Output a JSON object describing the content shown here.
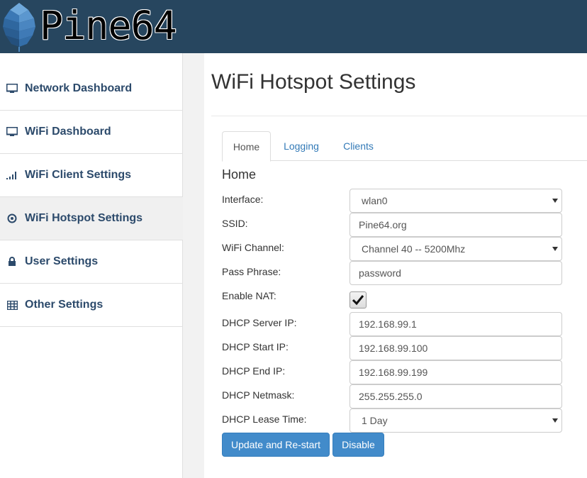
{
  "header": {
    "brand": "Pine64",
    "logo_icon": "pine-cone-logo-icon"
  },
  "colors": {
    "topbar": "#27465f",
    "nav_text": "#2c4a6b",
    "link": "#337ab7",
    "button": "#428bca"
  },
  "sidebar": {
    "items": [
      {
        "label": "Network Dashboard",
        "icon": "monitor-icon",
        "active": false
      },
      {
        "label": "WiFi Dashboard",
        "icon": "monitor-icon",
        "active": false
      },
      {
        "label": "WiFi Client Settings",
        "icon": "signal-bars-icon",
        "active": false
      },
      {
        "label": "WiFi Hotspot Settings",
        "icon": "radio-dot-icon",
        "active": true
      },
      {
        "label": "User Settings",
        "icon": "lock-icon",
        "active": false
      },
      {
        "label": "Other Settings",
        "icon": "table-icon",
        "active": false
      }
    ]
  },
  "main": {
    "title": "WiFi Hotspot Settings",
    "tabs": [
      {
        "label": "Home",
        "active": true
      },
      {
        "label": "Logging",
        "active": false
      },
      {
        "label": "Clients",
        "active": false
      }
    ],
    "section_title": "Home",
    "form": {
      "interface": {
        "label": "Interface:",
        "value": "wlan0"
      },
      "ssid": {
        "label": "SSID:",
        "value": "Pine64.org"
      },
      "channel": {
        "label": "WiFi Channel:",
        "value": "Channel 40 -- 5200Mhz"
      },
      "passphrase": {
        "label": "Pass Phrase:",
        "value": "password"
      },
      "nat": {
        "label": "Enable NAT:",
        "checked": true
      },
      "dhcp_server_ip": {
        "label": "DHCP Server IP:",
        "value": "192.168.99.1"
      },
      "dhcp_start_ip": {
        "label": "DHCP Start IP:",
        "value": "192.168.99.100"
      },
      "dhcp_end_ip": {
        "label": "DHCP End IP:",
        "value": "192.168.99.199"
      },
      "dhcp_netmask": {
        "label": "DHCP Netmask:",
        "value": "255.255.255.0"
      },
      "dhcp_lease": {
        "label": "DHCP Lease Time:",
        "value": "1 Day"
      }
    },
    "buttons": {
      "update": "Update and Re-start",
      "disable": "Disable"
    }
  }
}
